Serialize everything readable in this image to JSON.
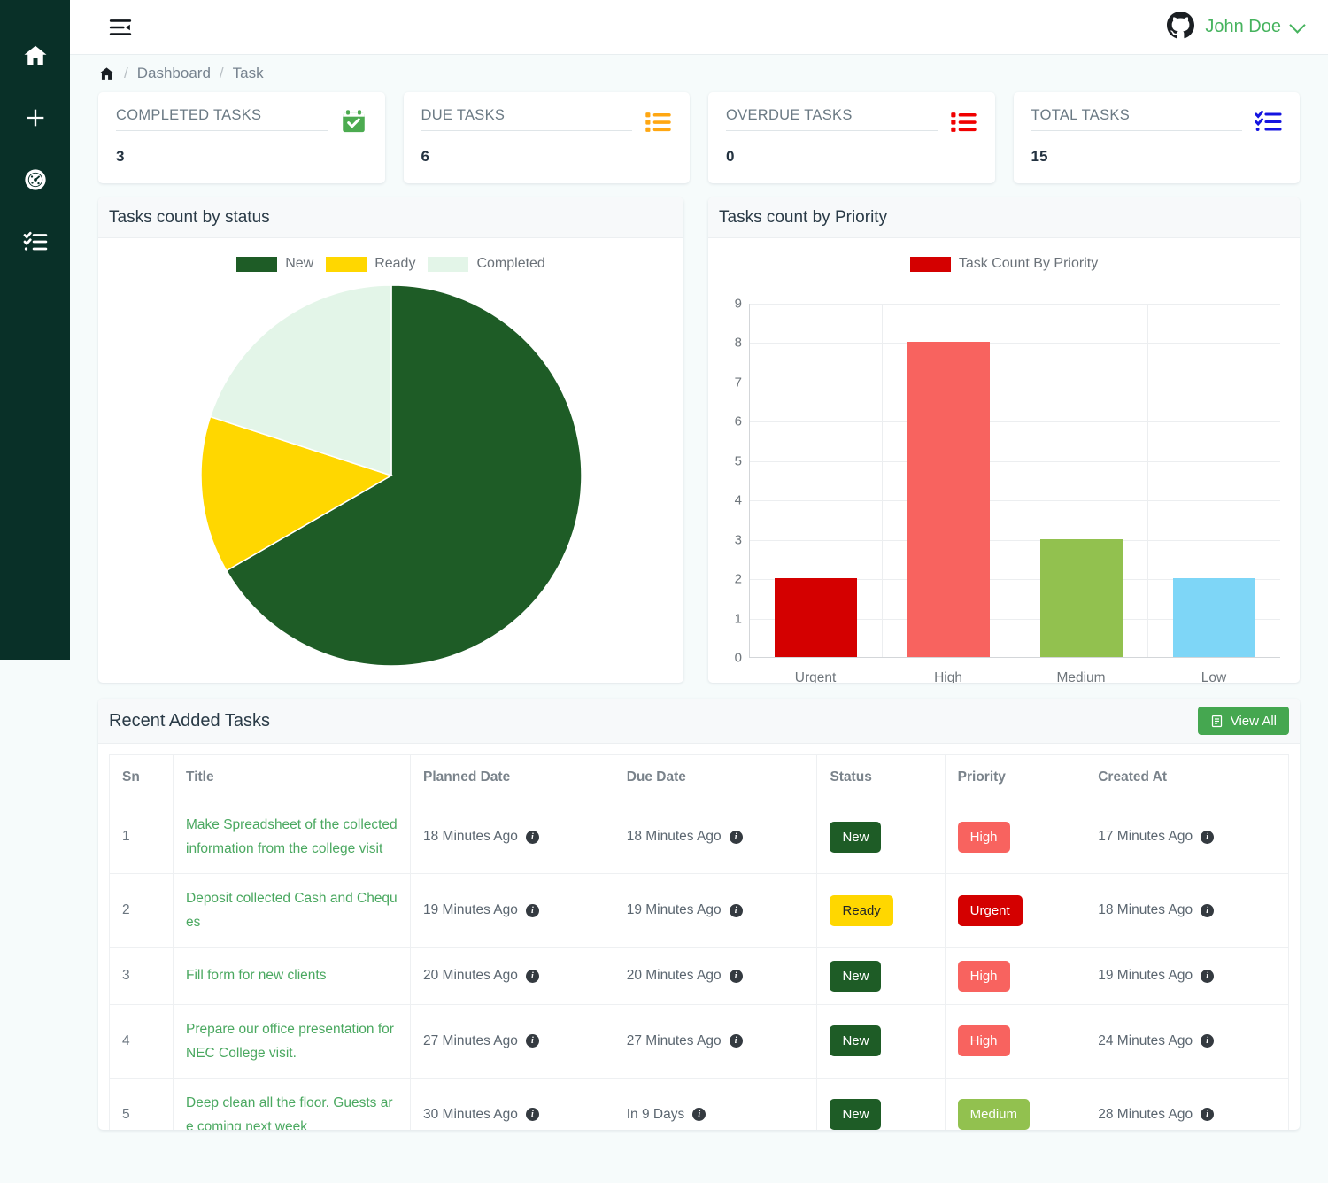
{
  "topbar": {
    "menu_icon": "menu-fold-icon",
    "avatar_icon": "github-avatar-icon",
    "user_name": "John Doe",
    "chevron_icon": "chevron-down-icon"
  },
  "sidebar": {
    "items": [
      {
        "name": "home",
        "icon": "home-icon"
      },
      {
        "name": "add",
        "icon": "plus-icon"
      },
      {
        "name": "dashboard",
        "icon": "speedometer-icon"
      },
      {
        "name": "tasks",
        "icon": "checklist-icon"
      }
    ]
  },
  "breadcrumb": {
    "home_icon": "home-icon",
    "items": [
      "Dashboard",
      "Task"
    ],
    "separator": "/"
  },
  "stats": [
    {
      "title": "COMPLETED TASKS",
      "value": "3",
      "icon": "calendar-check-icon",
      "color": "#4cab50"
    },
    {
      "title": "DUE TASKS",
      "value": "6",
      "icon": "list-icon",
      "color": "#ffa712"
    },
    {
      "title": "OVERDUE TASKS",
      "value": "0",
      "icon": "list-icon",
      "color": "#f00000"
    },
    {
      "title": "TOTAL TASKS",
      "value": "15",
      "icon": "checklist-icon",
      "color": "#1414e0"
    }
  ],
  "pie_panel": {
    "title": "Tasks count by status"
  },
  "bar_panel": {
    "title": "Tasks count by Priority"
  },
  "chart_data": [
    {
      "type": "pie",
      "title": "Tasks count by status",
      "legend_position": "top",
      "categories": [
        "New",
        "Ready",
        "Completed"
      ],
      "values": [
        10,
        2,
        3
      ],
      "colors": [
        "#1e5c26",
        "#ffd700",
        "#e3f5e8"
      ]
    },
    {
      "type": "bar",
      "title": "Tasks count by Priority",
      "legend": [
        "Task Count By Priority"
      ],
      "legend_color": "#d40000",
      "legend_position": "top",
      "categories": [
        "Urgent",
        "High",
        "Medium",
        "Low"
      ],
      "values": [
        2,
        8,
        3,
        2
      ],
      "colors": [
        "#d40000",
        "#f8635f",
        "#92c14f",
        "#7ed6f7"
      ],
      "xlabel": "",
      "ylabel": "",
      "ylim": [
        0,
        9
      ],
      "yticks": [
        0,
        1,
        2,
        3,
        4,
        5,
        6,
        7,
        8,
        9
      ],
      "grid": true
    }
  ],
  "recent": {
    "title": "Recent Added Tasks",
    "view_all_label": "View All",
    "view_all_icon": "document-icon",
    "columns": [
      "Sn",
      "Title",
      "Planned Date",
      "Due Date",
      "Status",
      "Priority",
      "Created At"
    ],
    "rows": [
      {
        "sn": "1",
        "title": "Make Spreadsheet of the collected information from the college visit",
        "planned_date": "18 Minutes Ago",
        "due_date": "18 Minutes Ago",
        "status": "New",
        "status_color": "#1e5c26",
        "priority": "High",
        "priority_color": "#f8635f",
        "created_at": "17 Minutes Ago"
      },
      {
        "sn": "2",
        "title": "Deposit collected Cash and Cheques",
        "planned_date": "19 Minutes Ago",
        "due_date": "19 Minutes Ago",
        "status": "Ready",
        "status_color": "#ffd700",
        "priority": "Urgent",
        "priority_color": "#d40000",
        "created_at": "18 Minutes Ago"
      },
      {
        "sn": "3",
        "title": "Fill form for new clients",
        "planned_date": "20 Minutes Ago",
        "due_date": "20 Minutes Ago",
        "status": "New",
        "status_color": "#1e5c26",
        "priority": "High",
        "priority_color": "#f8635f",
        "created_at": "19 Minutes Ago"
      },
      {
        "sn": "4",
        "title": "Prepare our office presentation for NEC College visit.",
        "planned_date": "27 Minutes Ago",
        "due_date": "27 Minutes Ago",
        "status": "New",
        "status_color": "#1e5c26",
        "priority": "High",
        "priority_color": "#f8635f",
        "created_at": "24 Minutes Ago"
      },
      {
        "sn": "5",
        "title": "Deep clean all the floor. Guests are coming next week",
        "planned_date": "30 Minutes Ago",
        "due_date": "In 9 Days",
        "status": "New",
        "status_color": "#1e5c26",
        "priority": "Medium",
        "priority_color": "#92c14f",
        "created_at": "28 Minutes Ago"
      }
    ],
    "info_icon_label": "i"
  }
}
